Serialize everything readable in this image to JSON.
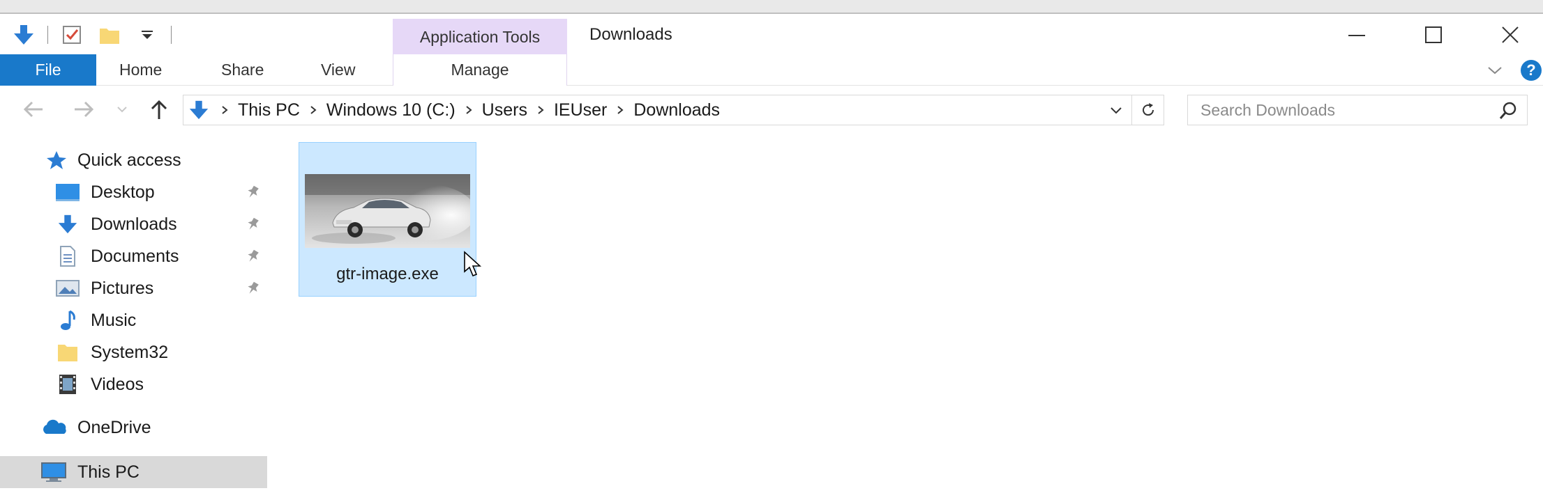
{
  "window": {
    "title": "Downloads",
    "contextual_tab_group": "Application Tools",
    "controls": {
      "minimize": "minimize-icon",
      "maximize": "maximize-icon",
      "close": "close-icon"
    }
  },
  "quick_access_toolbar": {
    "icons": [
      "down-arrow-icon",
      "properties-checkbox-icon",
      "new-folder-icon",
      "customize-dropdown-icon"
    ]
  },
  "ribbon": {
    "file_label": "File",
    "tabs": [
      "Home",
      "Share",
      "View"
    ],
    "contextual_tab": "Manage",
    "icons": [
      "expand-ribbon-chevron-icon",
      "help-icon"
    ],
    "help_glyph": "?"
  },
  "navigation": {
    "breadcrumb": [
      "This PC",
      "Windows 10 (C:)",
      "Users",
      "IEUser",
      "Downloads"
    ],
    "search_placeholder": "Search Downloads",
    "search_value": ""
  },
  "nav_pane": {
    "quick_access": "Quick access",
    "pinned": [
      {
        "label": "Desktop",
        "icon": "desktop-icon"
      },
      {
        "label": "Downloads",
        "icon": "downloads-icon"
      },
      {
        "label": "Documents",
        "icon": "documents-icon"
      },
      {
        "label": "Pictures",
        "icon": "pictures-icon"
      }
    ],
    "unpinned": [
      {
        "label": "Music",
        "icon": "music-icon"
      },
      {
        "label": "System32",
        "icon": "folder-icon"
      },
      {
        "label": "Videos",
        "icon": "videos-icon"
      }
    ],
    "onedrive": "OneDrive",
    "this_pc": "This PC",
    "selected": "This PC"
  },
  "files": [
    {
      "name": "gtr-image.exe",
      "thumbnail": "white sports car drifting on snow",
      "selected": true
    }
  ],
  "colors": {
    "file_tab": "#1979ca",
    "contextual_tab": "#e6d8f7",
    "selection": "#cce8ff",
    "selection_border": "#99d1ff",
    "nav_selected": "#d9d9d9",
    "accent_icon": "#2b7cd3"
  }
}
